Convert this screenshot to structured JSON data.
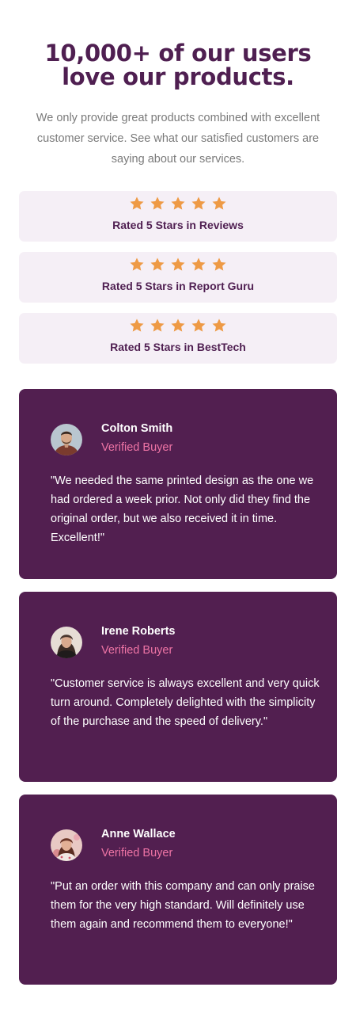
{
  "header": {
    "title_line1": "10,000+ of our users",
    "title_line2": "love our products.",
    "intro": "We only provide great products combined with excellent customer service. See what our satisfied customers are saying about our services."
  },
  "ratings": [
    {
      "stars": 5,
      "label": "Rated 5 Stars in Reviews"
    },
    {
      "stars": 5,
      "label": "Rated 5 Stars in Report Guru"
    },
    {
      "stars": 5,
      "label": "Rated 5 Stars in BestTech"
    }
  ],
  "testimonials": [
    {
      "name": "Colton Smith",
      "status": "Verified Buyer",
      "quote": "\"We needed the same printed design as the one we had ordered a week prior. Not only did they find the original order, but we also received it in time. Excellent!\""
    },
    {
      "name": "Irene Roberts",
      "status": "Verified Buyer",
      "quote": "\"Customer service is always excellent and very quick turn around. Completely delighted with the simplicity of the purchase and the speed of delivery.\""
    },
    {
      "name": "Anne Wallace",
      "status": "Verified Buyer",
      "quote": "\"Put an order with this company and can only praise them for the very high standard. Will definitely use them again and recommend them to everyone!\""
    }
  ],
  "colors": {
    "primary": "#521f50",
    "star": "#ee9a45",
    "accent_pink": "#ee74a5",
    "rating_bg": "#f5eff6"
  },
  "icons": {
    "star": "star-icon"
  }
}
